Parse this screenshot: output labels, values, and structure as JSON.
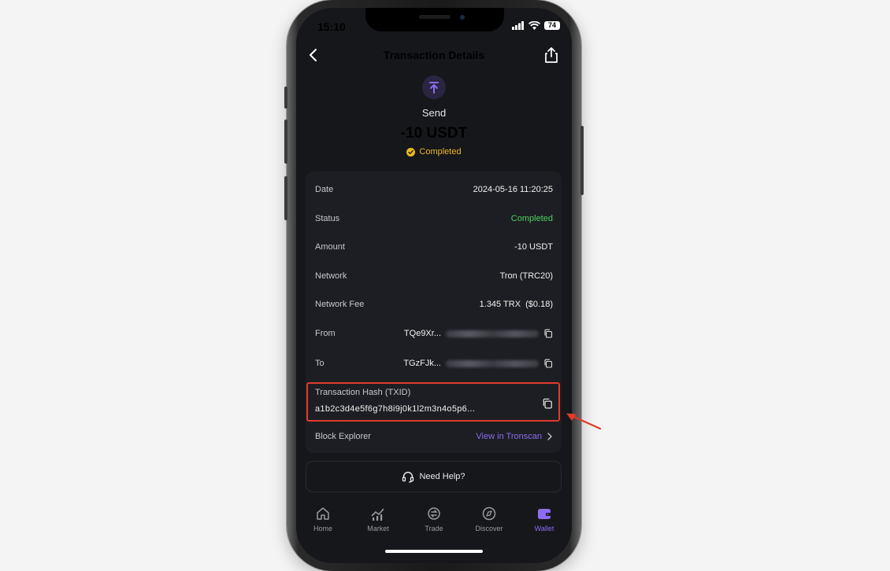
{
  "status_bar": {
    "time": "15:10",
    "battery": "74"
  },
  "header": {
    "title": "Transaction Details"
  },
  "summary": {
    "type": "Send",
    "amount": "-10 USDT",
    "status": "Completed"
  },
  "details": [
    {
      "label": "Date",
      "value": "2024-05-16 11:20:25"
    },
    {
      "label": "Status",
      "value": "Completed"
    },
    {
      "label": "Amount",
      "value": "-10 USDT"
    },
    {
      "label": "Network",
      "value": "Tron (TRC20)"
    },
    {
      "label": "Network Fee",
      "value": "1.345 TRX  ($0.18)"
    },
    {
      "label": "From",
      "value": "TQe9Xr..."
    },
    {
      "label": "To",
      "value": "TGzFJk..."
    }
  ],
  "hash": {
    "label": "Transaction Hash (TXID)",
    "value": "a1b2c3d4e5f6g7h8i9j0k1l2m3n4o5p6..."
  },
  "explorer": {
    "label": "Block Explorer",
    "link": "View in Tronscan"
  },
  "help": {
    "label": "Need Help?"
  },
  "tabs": [
    {
      "label": "Home",
      "icon": "home-icon"
    },
    {
      "label": "Market",
      "icon": "market-icon"
    },
    {
      "label": "Trade",
      "icon": "trade-icon"
    },
    {
      "label": "Discover",
      "icon": "compass-icon"
    },
    {
      "label": "Wallet",
      "icon": "wallet-icon",
      "active": true
    }
  ],
  "colors": {
    "accent": "#8c6cf2",
    "success": "#4ad15e",
    "pending": "#e8b923",
    "highlight": "#e03a2a"
  }
}
